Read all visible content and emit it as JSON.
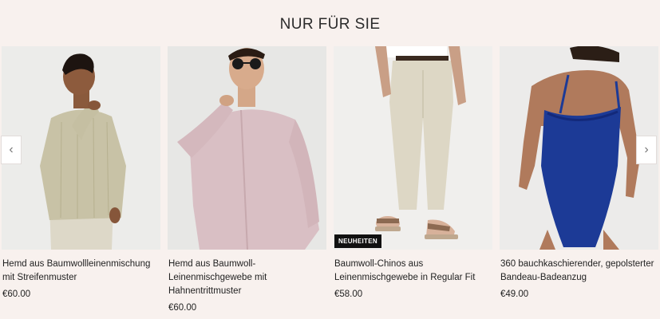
{
  "section": {
    "title": "NUR FÜR SIE"
  },
  "carousel": {
    "prev_icon": "chevron-left-icon",
    "next_icon": "chevron-right-icon",
    "products": [
      {
        "name": "Hemd aus Baumwollleinenmischung mit Streifenmuster",
        "price": "€60.00",
        "badge": ""
      },
      {
        "name": "Hemd aus Baumwoll-Leinenmischgewebe mit Hahnentrittmuster",
        "price": "€60.00",
        "badge": ""
      },
      {
        "name": "Baumwoll-Chinos aus Leinenmischgewebe in Regular Fit",
        "price": "€58.00",
        "badge": "NEUHEITEN"
      },
      {
        "name": "360 bauchkaschierender, gepolsterter Bandeau-Badeanzug",
        "price": "€49.00",
        "badge": ""
      }
    ]
  }
}
